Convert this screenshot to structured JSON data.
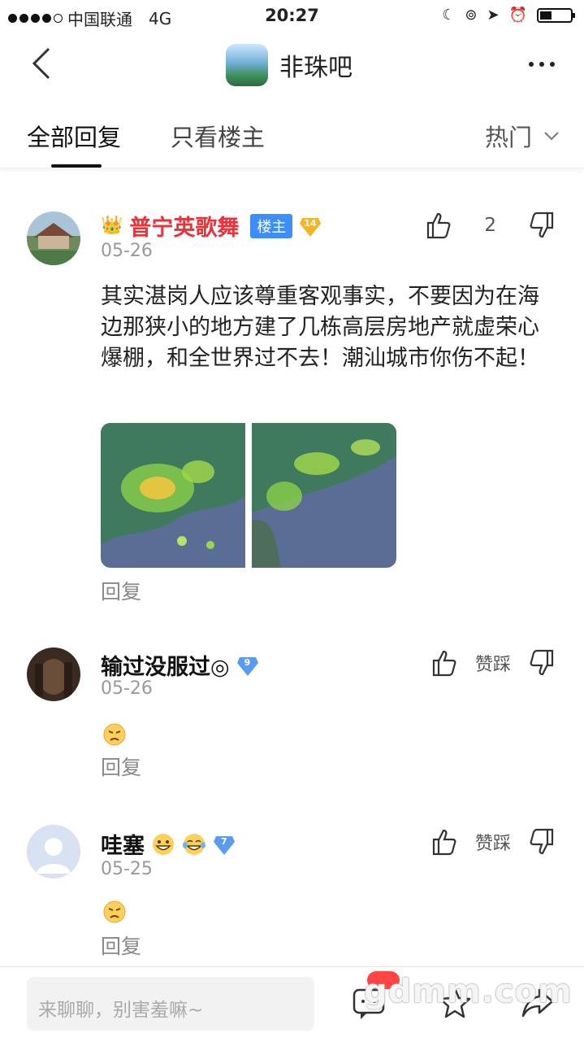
{
  "status_bar": {
    "carrier": "中国联通",
    "network": "4G",
    "time": "20:27"
  },
  "nav": {
    "forum_name": "非珠吧"
  },
  "tabs": {
    "all_replies": "全部回复",
    "owner_only": "只看楼主",
    "sort": "热门"
  },
  "posts": [
    {
      "crown": "👑",
      "username": "普宁英歌舞",
      "owner_badge": "楼主",
      "level": "14",
      "date": "05-26",
      "like_count": "2",
      "content": "其实湛岗人应该尊重客观事实，不要因为在海边那狭小的地方建了几栋高层房地产就虚荣心爆棚，和全世界过不去！潮汕城市你伤不起！",
      "reply_label": "回复"
    },
    {
      "username": "输过没服过◎",
      "level": "9",
      "date": "05-26",
      "like_label": "赞踩",
      "reply_label": "回复"
    },
    {
      "username": "哇塞",
      "level": "7",
      "date": "05-25",
      "like_label": "赞踩",
      "reply_label": "回复"
    }
  ],
  "bottom_bar": {
    "input_placeholder": "来聊聊，别害羞嘛~",
    "watermark": "gdmm.com"
  },
  "colors": {
    "accent_red": "#e8333a",
    "owner_badge": "#3e8ef7",
    "level_diamond": "#f5b52b",
    "level_diamond_blue": "#5b9bef"
  }
}
